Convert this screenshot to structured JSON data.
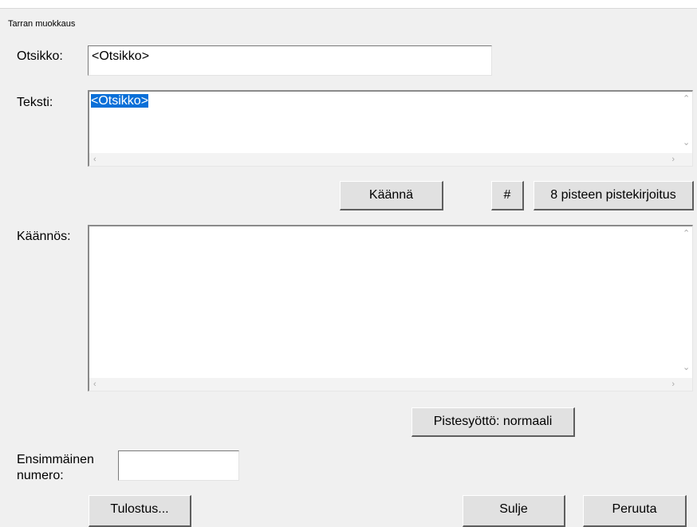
{
  "window": {
    "title": "Tarran muokkaus"
  },
  "fields": {
    "otsikko_label": "Otsikko:",
    "otsikko_value": "<Otsikko>",
    "teksti_label": "Teksti:",
    "teksti_value": "<Otsikko>",
    "kaannos_label": "Käännös:",
    "kaannos_value": "",
    "ensimmainen_label_line1": "Ensimmäinen",
    "ensimmainen_label_line2": "numero:",
    "ensimmainen_value": ""
  },
  "buttons": {
    "kaanna": "Käännä",
    "hash": "#",
    "braille8": "8 pisteen pistekirjoitus",
    "pistesyotto": "Pistesyöttö: normaali",
    "tulostus": "Tulostus...",
    "sulje": "Sulje",
    "peruuta": "Peruuta"
  },
  "icons": {
    "scroll_up": "up-arrow-icon",
    "scroll_down": "down-arrow-icon",
    "scroll_left": "left-arrow-icon",
    "scroll_right": "right-arrow-icon"
  },
  "colors": {
    "background": "#f0f0f0",
    "selection": "#0a6fd8"
  }
}
